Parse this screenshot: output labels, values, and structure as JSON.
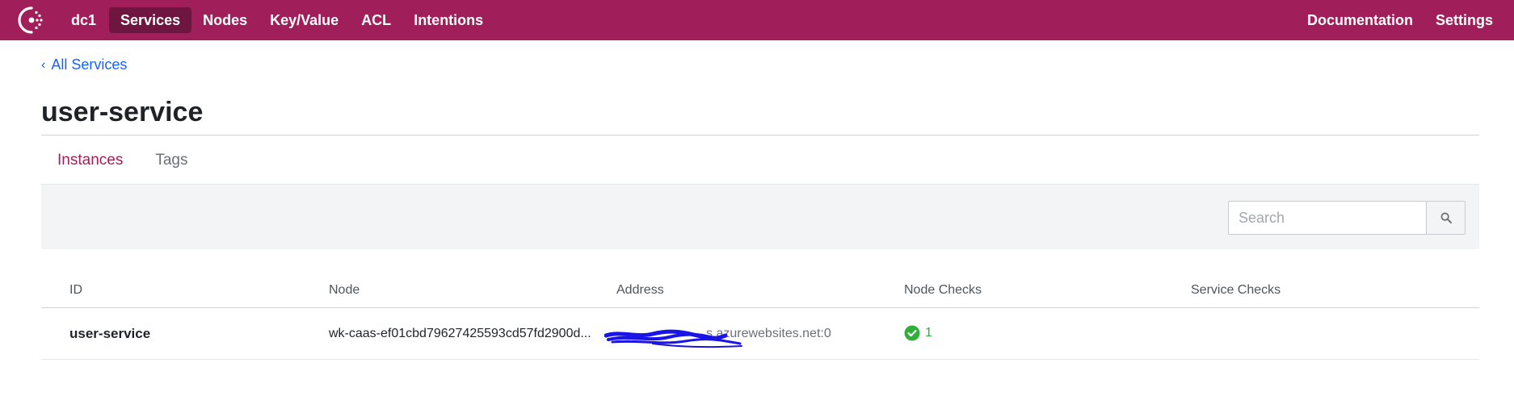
{
  "nav": {
    "datacenter": "dc1",
    "items": [
      "Services",
      "Nodes",
      "Key/Value",
      "ACL",
      "Intentions"
    ],
    "right_items": [
      "Documentation",
      "Settings"
    ]
  },
  "breadcrumb": {
    "label": "All Services"
  },
  "page": {
    "title": "user-service"
  },
  "tabs": [
    {
      "label": "Instances",
      "active": true
    },
    {
      "label": "Tags",
      "active": false
    }
  ],
  "search": {
    "placeholder": "Search",
    "value": ""
  },
  "table": {
    "columns": [
      "ID",
      "Node",
      "Address",
      "Node Checks",
      "Service Checks"
    ],
    "rows": [
      {
        "id": "user-service",
        "node": "wk-caas-ef01cbd79627425593cd57fd2900d...",
        "address": "s.azurewebsites.net:0",
        "node_checks": {
          "icon": "check-circle-icon",
          "passing": "1"
        },
        "service_checks": ""
      }
    ]
  },
  "colors": {
    "brand": "#a01f5a",
    "brand_active": "#6e1540",
    "link": "#1563ff",
    "passing": "#2eb039",
    "redaction": "#1a14e6"
  }
}
